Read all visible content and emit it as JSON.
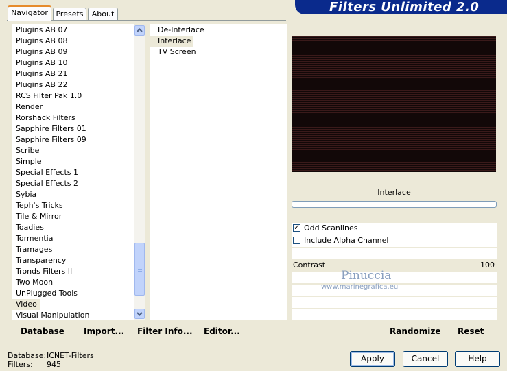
{
  "tabs": {
    "navigator": "Navigator",
    "presets": "Presets",
    "about": "About"
  },
  "banner": {
    "title": "Filters Unlimited 2.0"
  },
  "categories": [
    "Plugins AB 07",
    "Plugins AB 08",
    "Plugins AB 09",
    "Plugins AB 10",
    "Plugins AB 21",
    "Plugins AB 22",
    "RCS Filter Pak 1.0",
    "Render",
    "Rorshack Filters",
    "Sapphire Filters 01",
    "Sapphire Filters 09",
    "Scribe",
    "Simple",
    "Special Effects 1",
    "Special Effects 2",
    "Sybia",
    "Teph's Tricks",
    "Tile & Mirror",
    "Toadies",
    "Tormentia",
    "Tramages",
    "Transparency",
    "Tronds Filters II",
    "Two Moon",
    "UnPlugged Tools",
    "Video",
    "Visual Manipulation"
  ],
  "selected_category": "Video",
  "filters": [
    "De-Interlace",
    "Interlace",
    "TV Screen"
  ],
  "selected_filter": "Interlace",
  "filter_name": "Interlace",
  "options": {
    "odd_scanlines": "Odd Scanlines",
    "include_alpha": "Include Alpha Channel"
  },
  "contrast": {
    "label": "Contrast",
    "value": "100"
  },
  "watermark": {
    "name": "Pinuccia",
    "url": "www.marinegrafica.eu"
  },
  "bottom": {
    "database": "Database",
    "import": "Import...",
    "filter_info": "Filter Info...",
    "editor": "Editor...",
    "randomize": "Randomize",
    "reset": "Reset"
  },
  "status": {
    "database_label": "Database:",
    "database_value": "ICNET-Filters",
    "filters_label": "Filters:",
    "filters_value": "945"
  },
  "buttons": {
    "apply": "Apply",
    "cancel": "Cancel",
    "help": "Help"
  }
}
